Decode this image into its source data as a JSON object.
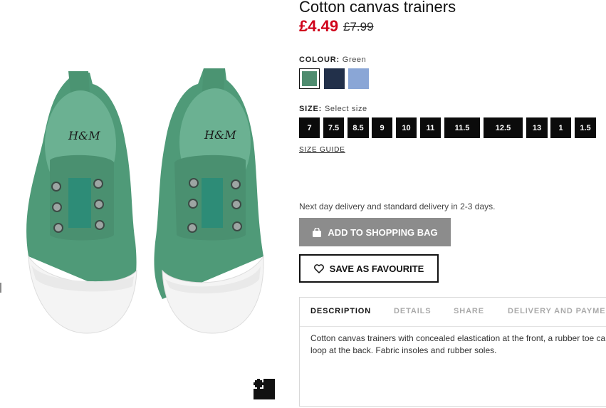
{
  "product": {
    "title": "Cotton canvas trainers",
    "price_now": "£4.49",
    "price_old": "£7.99",
    "image_alt": "Green canvas trainers",
    "brand_logo": "H&M"
  },
  "colour": {
    "label": "COLOUR:",
    "selected": "Green",
    "swatches": [
      {
        "name": "Green",
        "color": "#4f8c6f"
      },
      {
        "name": "Dark blue",
        "color": "#22304a"
      },
      {
        "name": "Light blue",
        "color": "#8aa6d6"
      }
    ]
  },
  "size": {
    "label": "SIZE:",
    "placeholder": "Select size",
    "options": [
      "7",
      "7.5",
      "8.5",
      "9",
      "10",
      "11",
      "11.5",
      "12.5",
      "13",
      "1",
      "1.5"
    ],
    "guide_label": "SIZE GUIDE"
  },
  "delivery": {
    "text": "Next day delivery and standard delivery in 2-3 days."
  },
  "actions": {
    "add_to_bag": "ADD TO SHOPPING BAG",
    "save_favourite": "SAVE AS FAVOURITE",
    "bag_icon": "shopping-bag-icon",
    "heart_icon": "heart-icon",
    "fullscreen_icon": "expand-icon"
  },
  "tabs": {
    "items": [
      "DESCRIPTION",
      "DETAILS",
      "SHARE",
      "DELIVERY AND PAYMEN"
    ],
    "active": "DESCRIPTION",
    "description": "Cotton canvas trainers with concealed elastication at the front, a rubber toe ca and loop at the back. Fabric insoles and rubber soles."
  },
  "colors": {
    "accent_price": "#d0021b",
    "button_grey": "#8c8c8c",
    "size_bg": "#0b0b0b",
    "shoe_green": "#4f9a78"
  }
}
